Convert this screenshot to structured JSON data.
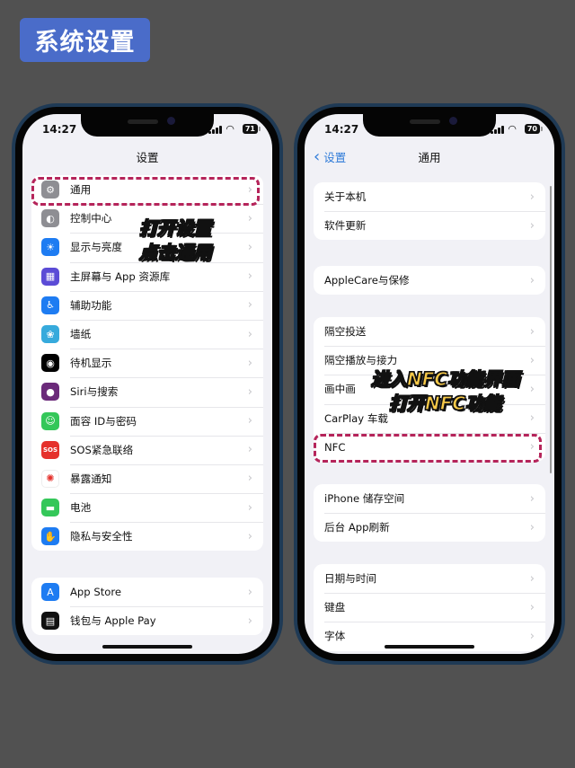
{
  "header_badge": "系统设置",
  "left_phone": {
    "status": {
      "time": "14:27",
      "battery": "71"
    },
    "nav_title": "设置",
    "groups": [
      {
        "items": [
          {
            "label": "通用",
            "icon": "gear-icon",
            "color": "#8e8e93",
            "glyph": "⚙"
          },
          {
            "label": "控制中心",
            "icon": "toggle-icon",
            "color": "#8e8e93",
            "glyph": "◐"
          },
          {
            "label": "显示与亮度",
            "icon": "sun-icon",
            "color": "#1e7cf2",
            "glyph": "☀"
          },
          {
            "label": "主屏幕与 App 资源库",
            "icon": "home-grid-icon",
            "color": "#5b4bd6",
            "glyph": "▦"
          },
          {
            "label": "辅助功能",
            "icon": "accessibility-icon",
            "color": "#1e7cf2",
            "glyph": "♿"
          },
          {
            "label": "墙纸",
            "icon": "flower-icon",
            "color": "#36aadc",
            "glyph": "❀"
          },
          {
            "label": "待机显示",
            "icon": "standby-icon",
            "color": "#000000",
            "glyph": "◉"
          },
          {
            "label": "Siri与搜索",
            "icon": "siri-icon",
            "color": "#6b2a7a",
            "glyph": "●"
          },
          {
            "label": "面容 ID与密码",
            "icon": "face-id-icon",
            "color": "#34c759",
            "glyph": "☺"
          },
          {
            "label": "SOS紧急联络",
            "icon": "sos-icon",
            "color": "#e5322d",
            "glyph": "SOS"
          },
          {
            "label": "暴露通知",
            "icon": "exposure-icon",
            "color": "#ffffff",
            "glyph": "✺"
          },
          {
            "label": "电池",
            "icon": "battery-icon",
            "color": "#34c759",
            "glyph": "▬"
          },
          {
            "label": "隐私与安全性",
            "icon": "hand-icon",
            "color": "#1e7cf2",
            "glyph": "✋"
          }
        ]
      },
      {
        "items": [
          {
            "label": "App Store",
            "icon": "app-store-icon",
            "color": "#1e7cf2",
            "glyph": "A"
          },
          {
            "label": "钱包与 Apple Pay",
            "icon": "wallet-icon",
            "color": "#111111",
            "glyph": "▤"
          }
        ]
      }
    ],
    "annotation": [
      "打开设置",
      "点击通用"
    ]
  },
  "right_phone": {
    "status": {
      "time": "14:27",
      "battery": "70"
    },
    "nav_title": "通用",
    "back_label": "设置",
    "groups": [
      {
        "items": [
          "关于本机",
          "软件更新"
        ]
      },
      {
        "items": [
          "AppleCare与保修"
        ]
      },
      {
        "items": [
          "隔空投送",
          "隔空播放与接力",
          "画中画",
          "CarPlay 车载",
          "NFC"
        ]
      },
      {
        "items": [
          "iPhone 储存空间",
          "后台 App刷新"
        ]
      },
      {
        "items": [
          "日期与时间",
          "键盘",
          "字体"
        ]
      }
    ],
    "annotation": [
      "进入NFC功能界面",
      "打开NFC功能"
    ]
  },
  "chevron": "›",
  "back_chevron": "‹",
  "wifi_glyph": "≋",
  "highlight_color": "#b5245a",
  "badge_color": "#4a6cc9"
}
